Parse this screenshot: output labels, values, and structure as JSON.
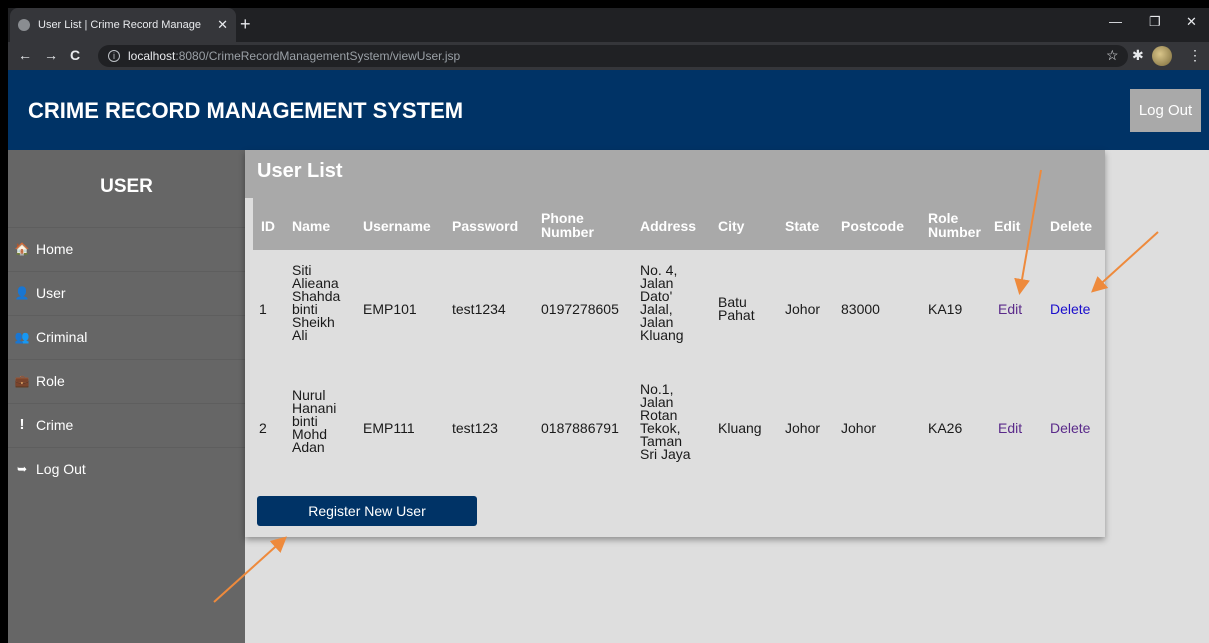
{
  "browser": {
    "tab_title": "User List | Crime Record Manage",
    "tab_close": "✕",
    "new_tab": "+",
    "url_host": "localhost",
    "url_path": ":8080/CrimeRecordManagementSystem/viewUser.jsp",
    "back": "←",
    "forward": "→",
    "reload": "C",
    "minimize": "—",
    "maximize": "❐",
    "close": "✕",
    "star": "☆",
    "menu": "⋮"
  },
  "header": {
    "title": "CRIME RECORD MANAGEMENT SYSTEM",
    "logout_label": "Log Out",
    "color": "#003366"
  },
  "sidebar": {
    "title": "USER",
    "items": [
      {
        "label": "Home",
        "icon": "home-icon",
        "glyph": "🏠"
      },
      {
        "label": "User",
        "icon": "user-icon",
        "glyph": "👤"
      },
      {
        "label": "Criminal",
        "icon": "users-icon",
        "glyph": "👥"
      },
      {
        "label": "Role",
        "icon": "briefcase-icon",
        "glyph": "💼"
      },
      {
        "label": "Crime",
        "icon": "exclamation-icon",
        "glyph": "!"
      },
      {
        "label": "Log Out",
        "icon": "sign-out-icon",
        "glyph": "➥"
      }
    ]
  },
  "user_list": {
    "title": "User List",
    "columns": {
      "id": "ID",
      "name": "Name",
      "username": "Username",
      "password": "Password",
      "phone_1": "Phone",
      "phone_2": "Number",
      "address": "Address",
      "city": "City",
      "state": "State",
      "postcode": "Postcode",
      "role_1": "Role",
      "role_2": "Number",
      "edit": "Edit",
      "delete": "Delete"
    },
    "rows": [
      {
        "id": "1",
        "name": [
          "Siti",
          "Alieana",
          "Shahda",
          "binti",
          "Sheikh",
          "Ali"
        ],
        "username": "EMP101",
        "password": "test1234",
        "phone": "0197278605",
        "address": [
          "No. 4,",
          "Jalan",
          "Dato'",
          "Jalal,",
          "Jalan",
          "Kluang"
        ],
        "city": [
          "Batu",
          "Pahat"
        ],
        "state": "Johor",
        "postcode": "83000",
        "role": "KA19",
        "edit": "Edit",
        "delete": "Delete"
      },
      {
        "id": "2",
        "name": [
          "Nurul",
          "Hanani",
          "binti",
          "Mohd",
          "Adan"
        ],
        "username": "EMP111",
        "password": "test123",
        "phone": "0187886791",
        "address": [
          "No.1,",
          "Jalan",
          "Rotan",
          "Tekok,",
          "Taman",
          "Sri Jaya"
        ],
        "city": [
          "Kluang"
        ],
        "state": "Johor",
        "postcode": "Johor",
        "role": "KA26",
        "edit": "Edit",
        "delete": "Delete"
      }
    ],
    "register_label": "Register New User"
  },
  "annotation_color": "#ee8a3c"
}
